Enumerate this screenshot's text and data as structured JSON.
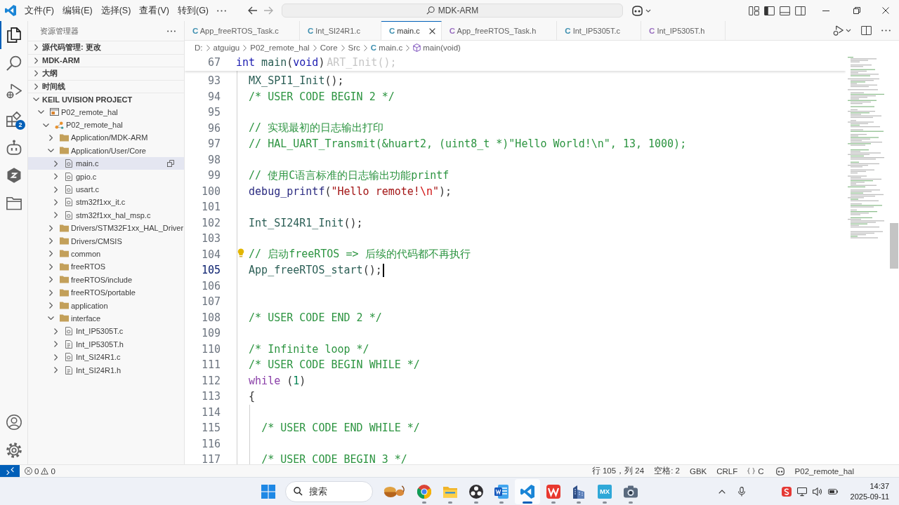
{
  "title_bar": {
    "menus": [
      "文件(F)",
      "编辑(E)",
      "选择(S)",
      "查看(V)",
      "转到(G)"
    ],
    "command_center": {
      "label": "MDK-ARM"
    }
  },
  "activity_bar": {
    "items": [
      {
        "kind": "explorer",
        "selected": true
      },
      {
        "kind": "search",
        "selected": false
      },
      {
        "kind": "run_debug",
        "selected": false
      },
      {
        "kind": "extensions",
        "selected": false,
        "badge": "2"
      },
      {
        "kind": "assistant",
        "selected": false
      },
      {
        "kind": "hexagon",
        "selected": false
      },
      {
        "kind": "folder",
        "selected": false
      }
    ],
    "bottom": [
      {
        "kind": "account"
      },
      {
        "kind": "settings"
      }
    ]
  },
  "sidebar": {
    "title": "资源管理器",
    "sections": [
      {
        "label": "源代码管理: 更改",
        "expanded": false
      },
      {
        "label": "MDK-ARM",
        "expanded": false
      },
      {
        "label": "大纲",
        "expanded": false
      },
      {
        "label": "时间线",
        "expanded": false
      },
      {
        "label": "KEIL UVISION PROJECT",
        "expanded": true,
        "tree": [
          {
            "label": "P02_remote_hal",
            "kind": "project",
            "expanded": true,
            "selected": false,
            "children": [
              {
                "label": "P02_remote_hal",
                "kind": "target",
                "expanded": true,
                "selected": false,
                "children": [
                  {
                    "label": "Application/MDK-ARM",
                    "kind": "folder",
                    "expanded": false,
                    "selected": false
                  },
                  {
                    "label": "Application/User/Core",
                    "kind": "folder",
                    "expanded": true,
                    "selected": false,
                    "children": [
                      {
                        "label": "main.c",
                        "kind": "c",
                        "expanded": false,
                        "selected": true
                      },
                      {
                        "label": "gpio.c",
                        "kind": "c",
                        "expanded": false,
                        "selected": false
                      },
                      {
                        "label": "usart.c",
                        "kind": "c",
                        "expanded": false,
                        "selected": false
                      },
                      {
                        "label": "stm32f1xx_it.c",
                        "kind": "c",
                        "expanded": false,
                        "selected": false
                      },
                      {
                        "label": "stm32f1xx_hal_msp.c",
                        "kind": "c",
                        "expanded": false,
                        "selected": false
                      }
                    ]
                  },
                  {
                    "label": "Drivers/STM32F1xx_HAL_Driver",
                    "kind": "folder",
                    "expanded": false,
                    "selected": false
                  },
                  {
                    "label": "Drivers/CMSIS",
                    "kind": "folder",
                    "expanded": false,
                    "selected": false
                  },
                  {
                    "label": "common",
                    "kind": "folder",
                    "expanded": false,
                    "selected": false
                  },
                  {
                    "label": "freeRTOS",
                    "kind": "folder",
                    "expanded": false,
                    "selected": false
                  },
                  {
                    "label": "freeRTOS/include",
                    "kind": "folder",
                    "expanded": false,
                    "selected": false
                  },
                  {
                    "label": "freeRTOS/portable",
                    "kind": "folder",
                    "expanded": false,
                    "selected": false
                  },
                  {
                    "label": "application",
                    "kind": "folder",
                    "expanded": false,
                    "selected": false
                  },
                  {
                    "label": "interface",
                    "kind": "folder",
                    "expanded": true,
                    "selected": false,
                    "children": [
                      {
                        "label": "Int_IP5305T.c",
                        "kind": "c",
                        "expanded": false,
                        "selected": false
                      },
                      {
                        "label": "Int_IP5305T.h",
                        "kind": "h",
                        "expanded": false,
                        "selected": false
                      },
                      {
                        "label": "Int_SI24R1.c",
                        "kind": "c",
                        "expanded": false,
                        "selected": false
                      },
                      {
                        "label": "Int_SI24R1.h",
                        "kind": "h",
                        "expanded": false,
                        "selected": false
                      }
                    ]
                  }
                ]
              }
            ]
          }
        ]
      }
    ]
  },
  "tabs": [
    {
      "icon": "C",
      "label": "App_freeRTOS_Task.c",
      "kind": "c",
      "selected": false
    },
    {
      "icon": "C",
      "label": "Int_SI24R1.c",
      "kind": "c",
      "selected": false
    },
    {
      "icon": "C",
      "label": "main.c",
      "kind": "c",
      "selected": true
    },
    {
      "icon": "C",
      "label": "App_freeRTOS_Task.h",
      "kind": "h",
      "selected": false
    },
    {
      "icon": "C",
      "label": "Int_IP5305T.c",
      "kind": "c",
      "selected": false
    },
    {
      "icon": "C",
      "label": "Int_IP5305T.h",
      "kind": "h",
      "selected": false
    }
  ],
  "breadcrumb": [
    {
      "kind": "folder",
      "label": "D:"
    },
    {
      "kind": "folder",
      "label": "atguigu"
    },
    {
      "kind": "folder",
      "label": "P02_remote_hal"
    },
    {
      "kind": "folder",
      "label": "Core"
    },
    {
      "kind": "folder",
      "label": "Src"
    },
    {
      "kind": "file",
      "icon": "C",
      "label": "main.c"
    },
    {
      "kind": "symbol",
      "label": "main(void)"
    }
  ],
  "editor": {
    "sticky": {
      "number": "67",
      "tokens": [
        {
          "kind": "keyword",
          "text": "int"
        },
        {
          "kind": "function",
          "text": " main"
        },
        {
          "kind": "plain",
          "text": "("
        },
        {
          "kind": "keyword",
          "text": "void"
        },
        {
          "kind": "plain",
          "text": ")"
        }
      ],
      "covered_text": "ART_Init();"
    },
    "lines": [
      {
        "number": "93",
        "current": false,
        "lightbulb": false,
        "tokens": [
          {
            "kind": "function",
            "text": "  MX_SPI1_Init"
          },
          {
            "kind": "plain",
            "text": "();"
          }
        ]
      },
      {
        "number": "94",
        "current": false,
        "lightbulb": false,
        "tokens": [
          {
            "kind": "comment",
            "text": "  /* USER CODE BEGIN 2 */"
          }
        ]
      },
      {
        "number": "95",
        "current": false,
        "lightbulb": false
      },
      {
        "number": "96",
        "current": false,
        "lightbulb": false,
        "tokens": [
          {
            "kind": "comment",
            "text": "  // 实现最初的日志输出打印"
          }
        ]
      },
      {
        "number": "97",
        "current": false,
        "lightbulb": false,
        "tokens": [
          {
            "kind": "comment",
            "text": "  // HAL_UART_Transmit(&huart2, (uint8_t *)\"Hello World!\\n\", 13, 1000);"
          }
        ]
      },
      {
        "number": "98",
        "current": false,
        "lightbulb": false
      },
      {
        "number": "99",
        "current": false,
        "lightbulb": false,
        "tokens": [
          {
            "kind": "comment",
            "text": "  // 使用C语言标准的日志输出功能printf"
          }
        ]
      },
      {
        "number": "100",
        "current": false,
        "lightbulb": false,
        "tokens": [
          {
            "kind": "macro",
            "text": "  debug_printf"
          },
          {
            "kind": "plain",
            "text": "("
          },
          {
            "kind": "string",
            "text": "\"Hello remote!"
          },
          {
            "kind": "escape",
            "text": "\\n"
          },
          {
            "kind": "string",
            "text": "\""
          },
          {
            "kind": "plain",
            "text": ");"
          }
        ]
      },
      {
        "number": "101",
        "current": false,
        "lightbulb": false
      },
      {
        "number": "102",
        "current": false,
        "lightbulb": false,
        "tokens": [
          {
            "kind": "function",
            "text": "  Int_SI24R1_Init"
          },
          {
            "kind": "plain",
            "text": "();"
          }
        ]
      },
      {
        "number": "103",
        "current": false,
        "lightbulb": false
      },
      {
        "number": "104",
        "current": false,
        "lightbulb": true,
        "tokens": [
          {
            "kind": "comment",
            "text": "  // 启动freeRTOS => 后续的代码都不再执行"
          }
        ]
      },
      {
        "number": "105",
        "current": true,
        "lightbulb": false,
        "tokens": [
          {
            "kind": "function",
            "text": "  App_freeRTOS_start"
          },
          {
            "kind": "plain",
            "text": "();"
          }
        ]
      },
      {
        "number": "106",
        "current": false,
        "lightbulb": false
      },
      {
        "number": "107",
        "current": false,
        "lightbulb": false
      },
      {
        "number": "108",
        "current": false,
        "lightbulb": false,
        "tokens": [
          {
            "kind": "comment",
            "text": "  /* USER CODE END 2 */"
          }
        ]
      },
      {
        "number": "109",
        "current": false,
        "lightbulb": false
      },
      {
        "number": "110",
        "current": false,
        "lightbulb": false,
        "tokens": [
          {
            "kind": "comment",
            "text": "  /* Infinite loop */"
          }
        ]
      },
      {
        "number": "111",
        "current": false,
        "lightbulb": false,
        "tokens": [
          {
            "kind": "comment",
            "text": "  /* USER CODE BEGIN WHILE */"
          }
        ]
      },
      {
        "number": "112",
        "current": false,
        "lightbulb": false,
        "tokens": [
          {
            "kind": "control",
            "text": "  while"
          },
          {
            "kind": "plain",
            "text": " ("
          },
          {
            "kind": "number",
            "text": "1"
          },
          {
            "kind": "plain",
            "text": ")"
          }
        ]
      },
      {
        "number": "113",
        "current": false,
        "lightbulb": false,
        "tokens": [
          {
            "kind": "plain",
            "text": "  {"
          }
        ]
      },
      {
        "number": "114",
        "current": false,
        "lightbulb": false
      },
      {
        "number": "115",
        "current": false,
        "lightbulb": false,
        "tokens": [
          {
            "kind": "comment",
            "text": "    /* USER CODE END WHILE */"
          }
        ]
      },
      {
        "number": "116",
        "current": false,
        "lightbulb": false
      },
      {
        "number": "117",
        "current": false,
        "lightbulb": false,
        "tokens": [
          {
            "kind": "comment",
            "text": "    /* USER CODE BEGIN 3 */"
          }
        ]
      }
    ]
  },
  "status_bar": {
    "problems": {
      "errors": "0",
      "warnings": "0"
    },
    "items": [
      {
        "kind": "text",
        "label": "行 105，列 24"
      },
      {
        "kind": "text",
        "label": "空格: 2"
      },
      {
        "kind": "text",
        "label": "GBK"
      },
      {
        "kind": "text",
        "label": "CRLF"
      },
      {
        "kind": "language",
        "label": "C"
      },
      {
        "kind": "assistant"
      },
      {
        "kind": "text",
        "label": "P02_remote_hal"
      }
    ]
  },
  "taskbar": {
    "search": {
      "placeholder": "搜索"
    },
    "apps": [
      {
        "kind": "widget",
        "selected": false
      },
      {
        "kind": "browser",
        "selected": false
      },
      {
        "kind": "files",
        "selected": false
      },
      {
        "kind": "recorder",
        "selected": false
      },
      {
        "kind": "document",
        "selected": false
      },
      {
        "kind": "code",
        "selected": true
      },
      {
        "kind": "office",
        "selected": false
      },
      {
        "kind": "building",
        "selected": false
      },
      {
        "kind": "tile",
        "label": "MX",
        "selected": false
      },
      {
        "kind": "camera",
        "selected": false
      }
    ],
    "clock": {
      "time": "14:37",
      "date": "2025-09-11"
    }
  }
}
